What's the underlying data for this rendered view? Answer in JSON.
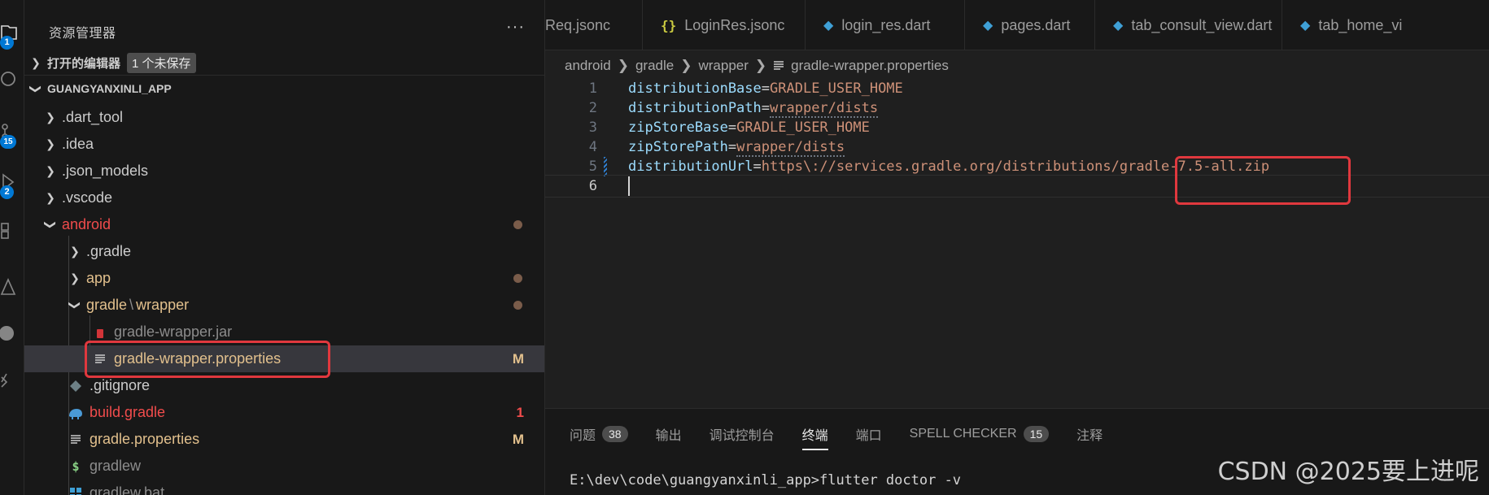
{
  "activity_bar": {
    "badges": [
      "1",
      "15",
      "2"
    ]
  },
  "sidebar": {
    "title": "资源管理器",
    "more": "···",
    "open_editors": {
      "label": "打开的编辑器",
      "unsaved": "1 个未保存"
    },
    "project": {
      "label": "GUANGYANXINLI_APP"
    },
    "tree": [
      {
        "label": ".dart_tool",
        "icon": "chevron-right",
        "color": "#cccccc"
      },
      {
        "label": ".idea",
        "icon": "chevron-right",
        "color": "#cccccc"
      },
      {
        "label": ".json_models",
        "icon": "chevron-right",
        "color": "#cccccc"
      },
      {
        "label": ".vscode",
        "icon": "chevron-right",
        "color": "#cccccc"
      },
      {
        "label": "android",
        "icon": "chevron-down",
        "color": "#f14c4c"
      },
      {
        "label": ".gradle",
        "icon": "chevron-right",
        "color": "#cccccc"
      },
      {
        "label": "app",
        "icon": "chevron-right",
        "color": "#e2c08d"
      },
      {
        "label": "gradle",
        "sep": "\\",
        "label2": "wrapper",
        "icon": "chevron-down",
        "color": "#e2c08d"
      },
      {
        "label": "gradle-wrapper.jar",
        "icon": "jar-file-icon",
        "color": "#8c8c8c"
      },
      {
        "label": "gradle-wrapper.properties",
        "icon": "properties-file-icon",
        "color": "#e2c08d",
        "decoration": "M"
      },
      {
        "label": ".gitignore",
        "icon": "git-file-icon",
        "color": "#cccccc"
      },
      {
        "label": "build.gradle",
        "icon": "gradle-elephant-icon",
        "color": "#f14c4c",
        "decoration": "1"
      },
      {
        "label": "gradle.properties",
        "icon": "properties-file-icon",
        "color": "#e2c08d",
        "decoration": "M"
      },
      {
        "label": "gradlew",
        "icon": "shell-file-icon",
        "color": "#cccccc"
      },
      {
        "label": "gradlew.bat",
        "icon": "windows-file-icon",
        "color": "#cccccc"
      }
    ]
  },
  "tabs": [
    {
      "label": "Req.jsonc",
      "icon": ""
    },
    {
      "label": "LoginRes.jsonc",
      "icon": "{}"
    },
    {
      "label": "login_res.dart",
      "icon": "dart-icon"
    },
    {
      "label": "pages.dart",
      "icon": "dart-icon"
    },
    {
      "label": "tab_consult_view.dart",
      "icon": "dart-icon"
    },
    {
      "label": "tab_home_vi",
      "icon": "dart-icon"
    }
  ],
  "breadcrumb": [
    "android",
    "gradle",
    "wrapper",
    "gradle-wrapper.properties"
  ],
  "code": [
    {
      "num": "1",
      "key": "distributionBase",
      "value": "GRADLE_USER_HOME"
    },
    {
      "num": "2",
      "key": "distributionPath",
      "value": "wrapper/dists"
    },
    {
      "num": "3",
      "key": "zipStoreBase",
      "value": "GRADLE_USER_HOME"
    },
    {
      "num": "4",
      "key": "zipStorePath",
      "value": "wrapper/dists"
    },
    {
      "num": "5",
      "key": "distributionUrl",
      "value": "https\\://services.gradle.org/distributions/gradle-7.5-all.zip"
    },
    {
      "num": "6",
      "key": "",
      "value": ""
    }
  ],
  "panel": {
    "tabs": [
      {
        "label": "问题",
        "badge": "38"
      },
      {
        "label": "输出"
      },
      {
        "label": "调试控制台"
      },
      {
        "label": "终端",
        "active": true
      },
      {
        "label": "端口"
      },
      {
        "label": "SPELL CHECKER",
        "badge": "15"
      },
      {
        "label": "注释"
      }
    ],
    "terminal": "E:\\dev\\code\\guangyanxinli_app>flutter doctor -v"
  },
  "watermark": "CSDN @2025要上进呢"
}
